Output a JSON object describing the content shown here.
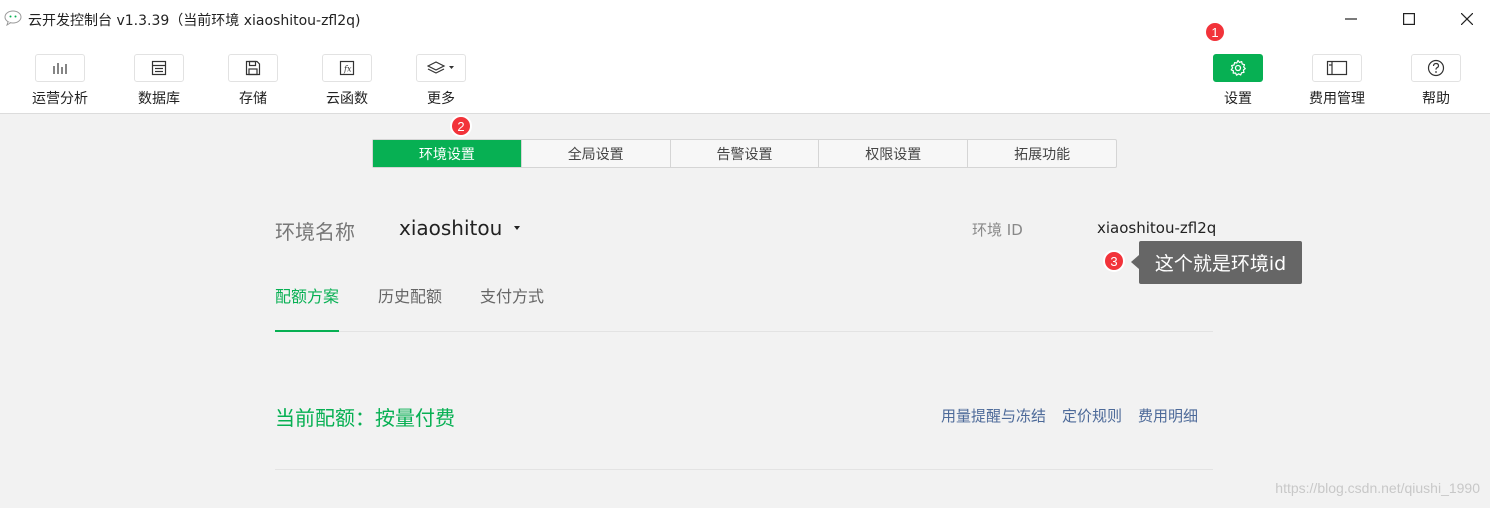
{
  "window": {
    "title": "云开发控制台 v1.3.39（当前环境 xiaoshitou-zfl2q)"
  },
  "toolbar": {
    "left_items": [
      {
        "label": "运营分析",
        "icon": "bar-chart-icon"
      },
      {
        "label": "数据库",
        "icon": "database-icon"
      },
      {
        "label": "存储",
        "icon": "floppy-disk-icon"
      },
      {
        "label": "云函数",
        "icon": "function-icon"
      },
      {
        "label": "更多",
        "icon": "layers-icon"
      }
    ],
    "right_items": [
      {
        "label": "设置",
        "icon": "gear-icon",
        "active": true
      },
      {
        "label": "费用管理",
        "icon": "billing-icon"
      },
      {
        "label": "帮助",
        "icon": "help-icon"
      }
    ]
  },
  "annotations": {
    "badge1": "1",
    "badge2": "2",
    "badge3": "3",
    "tooltip": "这个就是环境id"
  },
  "tabs": [
    "环境设置",
    "全局设置",
    "告警设置",
    "权限设置",
    "拓展功能"
  ],
  "env": {
    "name_label": "环境名称",
    "name_value": "xiaoshitou",
    "id_label": "环境 ID",
    "id_value": "xiaoshitou-zfl2q"
  },
  "subtabs": [
    "配额方案",
    "历史配额",
    "支付方式"
  ],
  "plan": {
    "title": "当前配额：按量付费",
    "links": [
      "用量提醒与冻结",
      "定价规则",
      "费用明细"
    ]
  },
  "watermark": "https://blog.csdn.net/qiushi_1990",
  "colors": {
    "accent": "#07b053",
    "badge": "#f2333a",
    "tooltip_bg": "#666666",
    "link": "#4d6a99"
  }
}
